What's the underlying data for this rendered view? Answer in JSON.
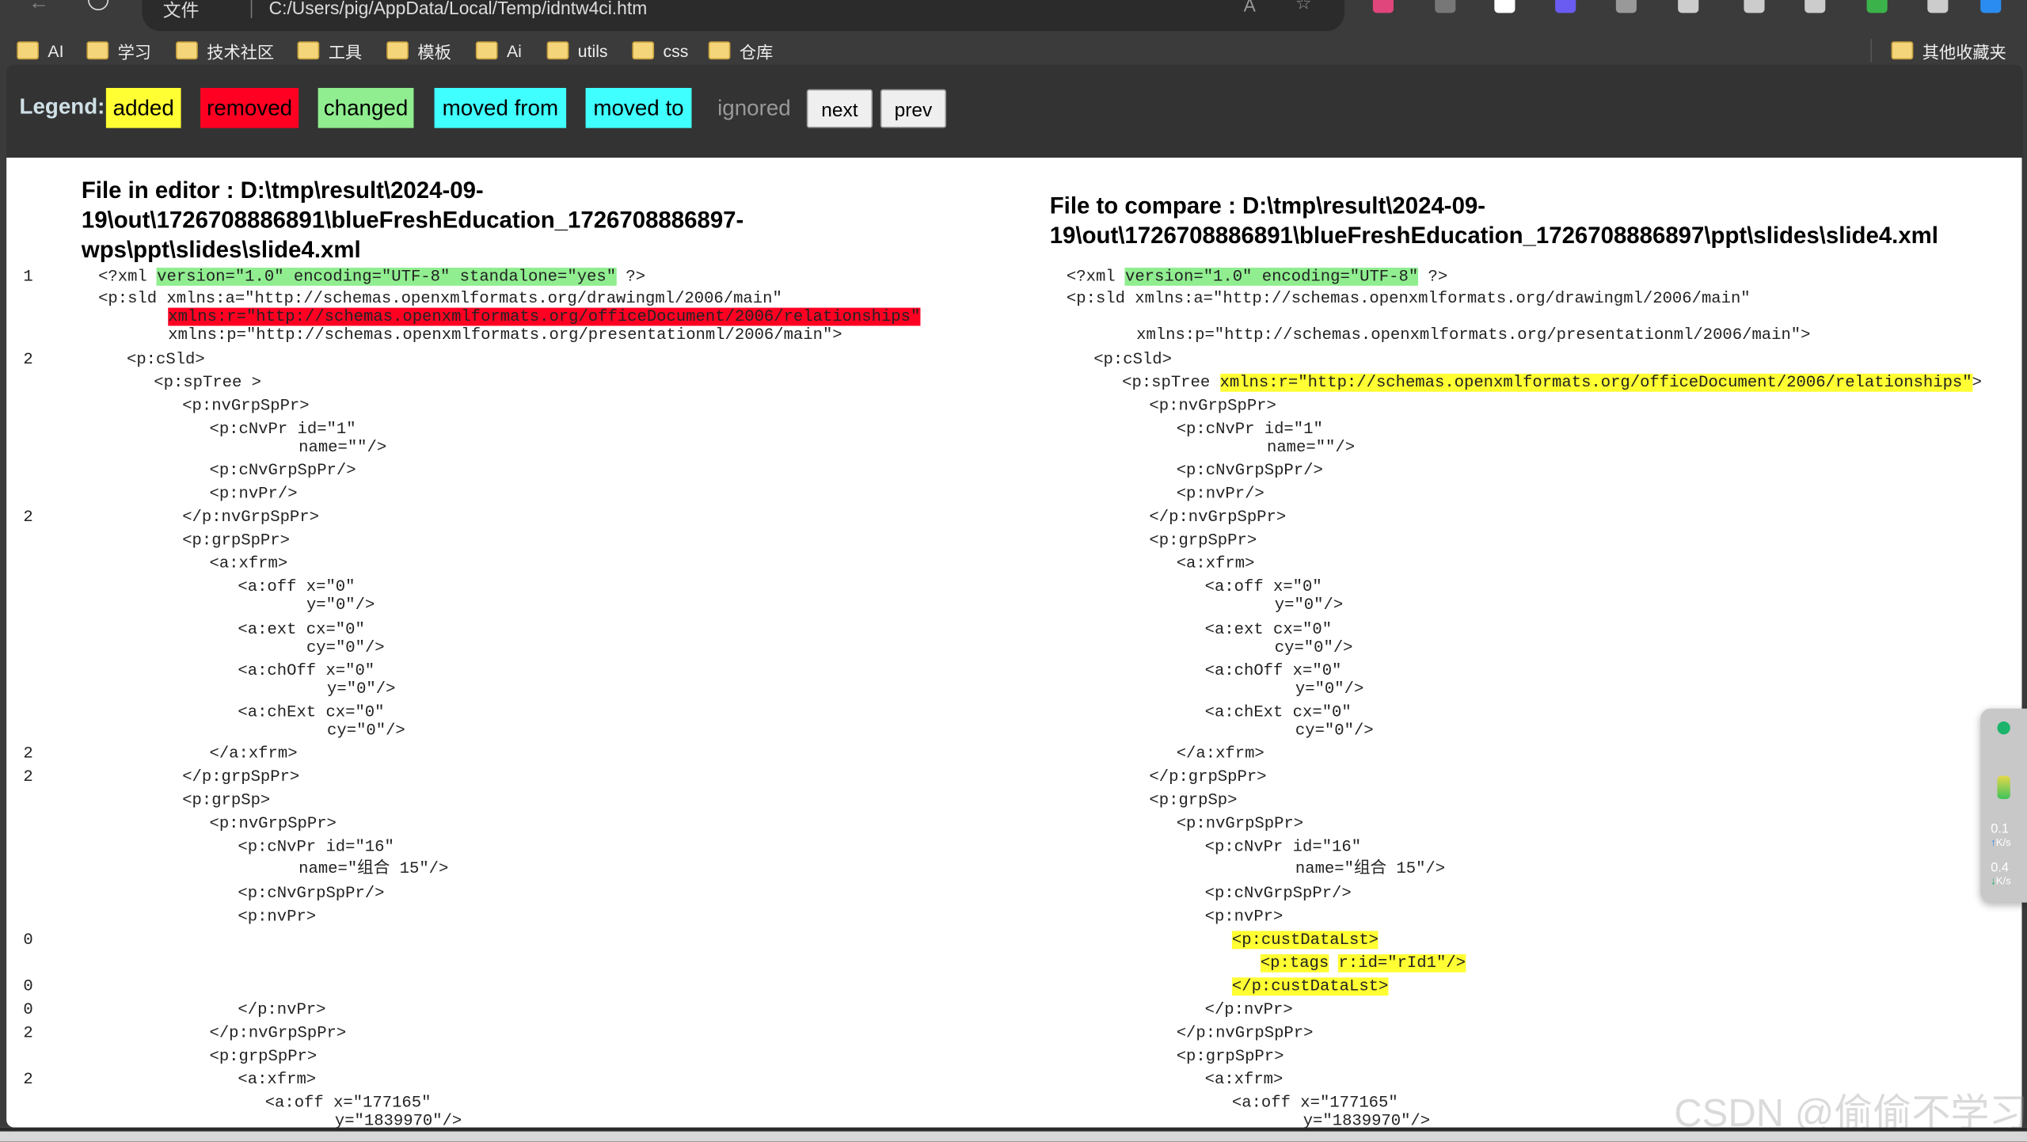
{
  "browser": {
    "address_prefix": "文件",
    "url": "C:/Users/pig/AppData/Local/Temp/idntw4ci.htm",
    "bookmarks": [
      "AI",
      "学习",
      "技术社区",
      "工具",
      "模板",
      "Ai",
      "utils",
      "css",
      "仓库"
    ],
    "other_bookmarks": "其他收藏夹",
    "toolbar_icons": [
      "translate-icon",
      "reader-icon",
      "qr-icon",
      "extension-purple-icon",
      "settings-gear-icon",
      "extensions-icon",
      "split-screen-icon",
      "favorites-icon",
      "shield-check-icon",
      "more-icon",
      "copilot-icon"
    ]
  },
  "legend": {
    "label": "Legend:",
    "items": [
      {
        "label": "added",
        "color": "#ffff33"
      },
      {
        "label": "removed",
        "color": "#ff0022"
      },
      {
        "label": "changed",
        "color": "#90ee90"
      },
      {
        "label": "moved from",
        "color": "#40ffff"
      },
      {
        "label": "moved to",
        "color": "#40ffff"
      }
    ],
    "ignored": "ignored",
    "next": "next",
    "prev": "prev"
  },
  "left": {
    "title": "File in editor : D:\\tmp\\result\\2024-09-19\\out\\1726708886891\\blueFreshEducation_1726708886897-wps\\ppt\\slides\\slide4.xml",
    "title_lines": [
      "File in editor : D:\\tmp\\result\\2024-09-",
      "19\\out\\1726708886891\\blueFreshEducation_1726708886897-",
      "wps\\ppt\\slides\\slide4.xml"
    ],
    "rows": [
      {
        "n": "1",
        "segs": [
          {
            "t": "<?xml "
          },
          {
            "t": "version=\"1.0\" encoding=\"UTF-8\" standalone=\"yes\"",
            "c": "changed"
          },
          {
            "t": " ?>"
          }
        ]
      },
      {
        "n": "",
        "segs": [
          {
            "t": "<p:sld xmlns:a=\"http://schemas.openxmlformats.org/drawingml/2006/main\""
          }
        ]
      },
      {
        "n": "",
        "segs": [
          {
            "t": "xmlns:r=\"http://schemas.openxmlformats.org/officeDocument/2006/relationships\"",
            "c": "removed"
          }
        ]
      },
      {
        "n": "",
        "segs": [
          {
            "t": "xmlns:p=\"http://schemas.openxmlformats.org/presentationml/2006/main\">"
          }
        ]
      },
      {
        "n": "2",
        "segs": [
          {
            "t": "<p:cSld>"
          }
        ]
      },
      {
        "n": "",
        "segs": [
          {
            "t": "<p:spTree >"
          }
        ]
      },
      {
        "n": "",
        "segs": [
          {
            "t": "<p:nvGrpSpPr>"
          }
        ]
      },
      {
        "n": "",
        "segs": [
          {
            "t": "<p:cNvPr id=\"1\""
          }
        ]
      },
      {
        "n": "",
        "segs": [
          {
            "t": "name=\"\"/>"
          }
        ]
      },
      {
        "n": "",
        "segs": [
          {
            "t": "<p:cNvGrpSpPr/>"
          }
        ]
      },
      {
        "n": "",
        "segs": [
          {
            "t": "<p:nvPr/>"
          }
        ]
      },
      {
        "n": "2",
        "segs": [
          {
            "t": "</p:nvGrpSpPr>"
          }
        ]
      },
      {
        "n": "",
        "segs": [
          {
            "t": "<p:grpSpPr>"
          }
        ]
      },
      {
        "n": "",
        "segs": [
          {
            "t": "<a:xfrm>"
          }
        ]
      },
      {
        "n": "",
        "segs": [
          {
            "t": "<a:off x=\"0\""
          }
        ]
      },
      {
        "n": "",
        "segs": [
          {
            "t": "y=\"0\"/>"
          }
        ]
      },
      {
        "n": "",
        "segs": [
          {
            "t": "<a:ext cx=\"0\""
          }
        ]
      },
      {
        "n": "",
        "segs": [
          {
            "t": "cy=\"0\"/>"
          }
        ]
      },
      {
        "n": "",
        "segs": [
          {
            "t": "<a:chOff x=\"0\""
          }
        ]
      },
      {
        "n": "",
        "segs": [
          {
            "t": "y=\"0\"/>"
          }
        ]
      },
      {
        "n": "",
        "segs": [
          {
            "t": "<a:chExt cx=\"0\""
          }
        ]
      },
      {
        "n": "",
        "segs": [
          {
            "t": "cy=\"0\"/>"
          }
        ]
      },
      {
        "n": "2",
        "segs": [
          {
            "t": "</a:xfrm>"
          }
        ]
      },
      {
        "n": "2",
        "segs": [
          {
            "t": "</p:grpSpPr>"
          }
        ]
      },
      {
        "n": "",
        "segs": [
          {
            "t": "<p:grpSp>"
          }
        ]
      },
      {
        "n": "",
        "segs": [
          {
            "t": "<p:nvGrpSpPr>"
          }
        ]
      },
      {
        "n": "",
        "segs": [
          {
            "t": "<p:cNvPr id=\"16\""
          }
        ]
      },
      {
        "n": "",
        "segs": [
          {
            "t": "name=\"组合 15\"/>"
          }
        ]
      },
      {
        "n": "",
        "segs": [
          {
            "t": "<p:cNvGrpSpPr/>"
          }
        ]
      },
      {
        "n": "",
        "segs": [
          {
            "t": "<p:nvPr>"
          }
        ]
      },
      {
        "n": "0",
        "segs": []
      },
      {
        "n": "0",
        "segs": []
      },
      {
        "n": "0",
        "segs": [
          {
            "t": "</p:nvPr>"
          }
        ]
      },
      {
        "n": "2",
        "segs": [
          {
            "t": "</p:nvGrpSpPr>"
          }
        ]
      },
      {
        "n": "",
        "segs": [
          {
            "t": "<p:grpSpPr>"
          }
        ]
      },
      {
        "n": "2",
        "segs": [
          {
            "t": "<a:xfrm>"
          }
        ]
      },
      {
        "n": "",
        "segs": [
          {
            "t": "<a:off x=\"177165\""
          }
        ]
      },
      {
        "n": "",
        "segs": [
          {
            "t": "y=\"1839970\"/>"
          }
        ]
      }
    ]
  },
  "right": {
    "title": "File to compare : D:\\tmp\\result\\2024-09-19\\out\\1726708886891\\blueFreshEducation_1726708886897\\ppt\\slides\\slide4.xml",
    "title_lines": [
      "File to compare : D:\\tmp\\result\\2024-09-",
      "19\\out\\1726708886891\\blueFreshEducation_1726708886897\\ppt\\slides\\slide4.xml"
    ],
    "rows": [
      {
        "segs": [
          {
            "t": "<?xml "
          },
          {
            "t": "version=\"1.0\" encoding=\"UTF-8\"",
            "c": "changed"
          },
          {
            "t": " ?>"
          }
        ]
      },
      {
        "segs": [
          {
            "t": "<p:sld xmlns:a=\"http://schemas.openxmlformats.org/drawingml/2006/main\""
          }
        ]
      },
      {
        "segs": [
          {
            "t": "xmlns:p=\"http://schemas.openxmlformats.org/presentationml/2006/main\">"
          }
        ]
      },
      {
        "segs": [
          {
            "t": "<p:cSld>"
          }
        ]
      },
      {
        "segs": [
          {
            "t": "<p:spTree "
          },
          {
            "t": "xmlns:r=\"http://schemas.openxmlformats.org/officeDocument/2006/relationships\"",
            "c": "added"
          },
          {
            "t": ">"
          }
        ]
      },
      {
        "segs": [
          {
            "t": "<p:nvGrpSpPr>"
          }
        ]
      },
      {
        "segs": [
          {
            "t": "<p:cNvPr id=\"1\""
          }
        ]
      },
      {
        "segs": [
          {
            "t": "name=\"\"/>"
          }
        ]
      },
      {
        "segs": [
          {
            "t": "<p:cNvGrpSpPr/>"
          }
        ]
      },
      {
        "segs": [
          {
            "t": "<p:nvPr/>"
          }
        ]
      },
      {
        "segs": [
          {
            "t": "</p:nvGrpSpPr>"
          }
        ]
      },
      {
        "segs": [
          {
            "t": "<p:grpSpPr>"
          }
        ]
      },
      {
        "segs": [
          {
            "t": "<a:xfrm>"
          }
        ]
      },
      {
        "segs": [
          {
            "t": "<a:off x=\"0\""
          }
        ]
      },
      {
        "segs": [
          {
            "t": "y=\"0\"/>"
          }
        ]
      },
      {
        "segs": [
          {
            "t": "<a:ext cx=\"0\""
          }
        ]
      },
      {
        "segs": [
          {
            "t": "cy=\"0\"/>"
          }
        ]
      },
      {
        "segs": [
          {
            "t": "<a:chOff x=\"0\""
          }
        ]
      },
      {
        "segs": [
          {
            "t": "y=\"0\"/>"
          }
        ]
      },
      {
        "segs": [
          {
            "t": "<a:chExt cx=\"0\""
          }
        ]
      },
      {
        "segs": [
          {
            "t": "cy=\"0\"/>"
          }
        ]
      },
      {
        "segs": [
          {
            "t": "</a:xfrm>"
          }
        ]
      },
      {
        "segs": [
          {
            "t": "</p:grpSpPr>"
          }
        ]
      },
      {
        "segs": [
          {
            "t": "<p:grpSp>"
          }
        ]
      },
      {
        "segs": [
          {
            "t": "<p:nvGrpSpPr>"
          }
        ]
      },
      {
        "segs": [
          {
            "t": "<p:cNvPr id=\"16\""
          }
        ]
      },
      {
        "segs": [
          {
            "t": "name=\"组合 15\"/>"
          }
        ]
      },
      {
        "segs": [
          {
            "t": "<p:cNvGrpSpPr/>"
          }
        ]
      },
      {
        "segs": [
          {
            "t": "<p:nvPr>"
          }
        ]
      },
      {
        "segs": [
          {
            "t": "<p:custDataLst>",
            "c": "added"
          }
        ]
      },
      {
        "segs": [
          {
            "t": "<p:tags",
            "c": "added"
          },
          {
            "t": " "
          },
          {
            "t": "r:id=\"rId1\"/>",
            "c": "added"
          }
        ]
      },
      {
        "segs": [
          {
            "t": "</p:custDataLst>",
            "c": "added"
          }
        ]
      },
      {
        "segs": [
          {
            "t": "</p:nvPr>"
          }
        ]
      },
      {
        "segs": [
          {
            "t": "</p:nvGrpSpPr>"
          }
        ]
      },
      {
        "segs": [
          {
            "t": "<p:grpSpPr>"
          }
        ]
      },
      {
        "segs": [
          {
            "t": "<a:xfrm>"
          }
        ]
      },
      {
        "segs": [
          {
            "t": "<a:off x=\"177165\""
          }
        ]
      },
      {
        "segs": [
          {
            "t": "y=\"1839970\"/>"
          }
        ]
      }
    ]
  },
  "net_widget": {
    "up": "0.1",
    "up_unit": "K/s",
    "down": "0.4",
    "down_unit": "K/s"
  },
  "watermark": "CSDN @偷偷不学习"
}
